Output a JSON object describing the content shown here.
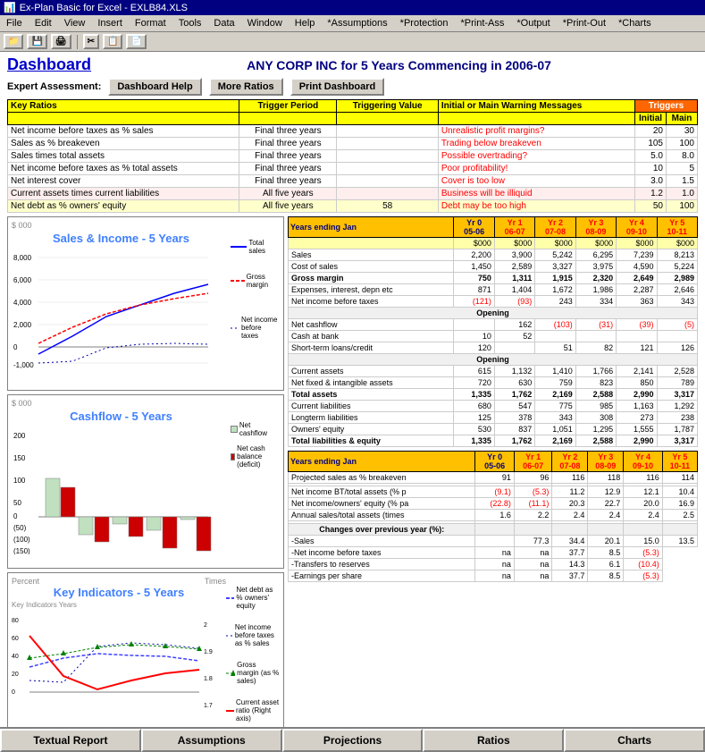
{
  "titlebar": {
    "title": "Ex-Plan Basic for Excel - EXLB84.XLS",
    "icon": "📊"
  },
  "menubar": {
    "items": [
      "File",
      "Edit",
      "View",
      "Insert",
      "Format",
      "Tools",
      "Data",
      "Window",
      "Help",
      "*Assumptions",
      "*Protection",
      "*Print-Ass",
      "*Output",
      "*Print-Out",
      "*Charts"
    ]
  },
  "dashboard": {
    "title": "Dashboard",
    "subtitle": "ANY CORP INC for 5 Years Commencing in 2006-07",
    "expert_label": "Expert Assessment:",
    "buttons": {
      "help": "Dashboard Help",
      "more_ratios": "More Ratios",
      "print": "Print Dashboard"
    }
  },
  "ratios_table": {
    "headers": [
      "Key Ratios",
      "Trigger Period",
      "Triggering Value",
      "Initial or Main Warning Messages",
      "Triggers Initial",
      "Triggers Main"
    ],
    "rows": [
      {
        "name": "Net income before taxes as % sales",
        "period": "Final three years",
        "value": "",
        "warning": "Unrealistic profit margins?",
        "initial": "20",
        "main": "30"
      },
      {
        "name": "Sales as % breakeven",
        "period": "Final three years",
        "value": "",
        "warning": "Trading below breakeven",
        "initial": "105",
        "main": "100"
      },
      {
        "name": "Sales times total assets",
        "period": "Final three years",
        "value": "",
        "warning": "Possible overtrading?",
        "initial": "5.0",
        "main": "8.0"
      },
      {
        "name": "Net income before taxes as % total assets",
        "period": "Final three years",
        "value": "",
        "warning": "Poor profitability!",
        "initial": "10",
        "main": "5"
      },
      {
        "name": "Net interest cover",
        "period": "Final three years",
        "value": "",
        "warning": "Cover is too low",
        "initial": "3.0",
        "main": "1.5"
      },
      {
        "name": "Current assets times current liabilities",
        "period": "All five years",
        "value": "",
        "warning": "Business will be illiquid",
        "initial": "1.2",
        "main": "1.0"
      },
      {
        "name": "Net debt as % owners' equity",
        "period": "All five years",
        "value": "58",
        "warning": "Debt may be too high",
        "initial": "50",
        "main": "100"
      }
    ]
  },
  "financial_data": {
    "years_header": [
      "Years ending Jan",
      "Yr 0 05-06",
      "Yr 1 06-07",
      "Yr 2 07-08",
      "Yr 3 08-09",
      "Yr 4 09-10",
      "Yr 5 10-11"
    ],
    "unit_row": [
      "$000",
      "$000",
      "$000",
      "$000",
      "$000",
      "$000"
    ],
    "income": [
      {
        "label": "Sales",
        "values": [
          "2,200",
          "3,900",
          "5,242",
          "6,295",
          "7,239",
          "8,213"
        ]
      },
      {
        "label": "Cost of sales",
        "values": [
          "1,450",
          "2,589",
          "3,327",
          "3,975",
          "4,590",
          "5,224"
        ]
      },
      {
        "label": "Gross margin",
        "values": [
          "750",
          "1,311",
          "1,915",
          "2,320",
          "2,649",
          "2,989"
        ]
      }
    ],
    "expenses": [
      {
        "label": "Expenses, interest, depn etc",
        "values": [
          "871",
          "1,404",
          "1,672",
          "1,986",
          "2,287",
          "2,646"
        ]
      },
      {
        "label": "Net income before taxes",
        "values": [
          "(121)",
          "(93)",
          "243",
          "334",
          "363",
          "343"
        ]
      }
    ],
    "cashflow": [
      {
        "label": "Net cashflow",
        "values": [
          "",
          "162",
          "(103)",
          "(31)",
          "(39)",
          "(5)"
        ]
      },
      {
        "label": "Cash at bank",
        "values": [
          "10",
          "52",
          "",
          "",
          "",
          ""
        ]
      },
      {
        "label": "Short-term loans/credit",
        "values": [
          "120",
          "",
          "51",
          "82",
          "121",
          "126"
        ]
      }
    ],
    "assets": [
      {
        "label": "Current assets",
        "values": [
          "615",
          "1,132",
          "1,410",
          "1,766",
          "2,141",
          "2,528"
        ]
      },
      {
        "label": "Net fixed & intangible assets",
        "values": [
          "720",
          "630",
          "759",
          "823",
          "850",
          "789"
        ]
      },
      {
        "label": "Total assets",
        "values": [
          "1,335",
          "1,762",
          "2,169",
          "2,588",
          "2,990",
          "3,317"
        ]
      }
    ],
    "liabilities": [
      {
        "label": "Current liabilities",
        "values": [
          "680",
          "547",
          "775",
          "985",
          "1,163",
          "1,292"
        ]
      },
      {
        "label": "Longterm liabilities",
        "values": [
          "125",
          "378",
          "343",
          "308",
          "273",
          "238"
        ]
      },
      {
        "label": "Owners' equity",
        "values": [
          "530",
          "837",
          "1,051",
          "1,295",
          "1,555",
          "1,787"
        ]
      },
      {
        "label": "Total liabilities & equity",
        "values": [
          "1,335",
          "1,762",
          "2,169",
          "2,588",
          "2,990",
          "3,317"
        ]
      }
    ]
  },
  "ratios_data": {
    "years_header": [
      "Years ending Jan",
      "Yr 0 05-06",
      "Yr 1 06-07",
      "Yr 2 07-08",
      "Yr 3 08-09",
      "Yr 4 09-10",
      "Yr 5 10-11"
    ],
    "rows": [
      {
        "label": "Projected sales as % breakeven",
        "values": [
          "91",
          "96",
          "116",
          "118",
          "116",
          "114"
        ]
      },
      {
        "label": "",
        "values": [
          "",
          "",
          "",
          "",
          "",
          ""
        ]
      },
      {
        "label": "Net income BT/total assets (% p",
        "values": [
          "(9.1)",
          "(5.3)",
          "11.2",
          "12.9",
          "12.1",
          "10.4"
        ],
        "neg": [
          true,
          true,
          false,
          false,
          false,
          false
        ]
      },
      {
        "label": "Net income/owners' equity (% pa",
        "values": [
          "(22.8)",
          "(11.1)",
          "20.3",
          "22.7",
          "20.0",
          "16.9"
        ],
        "neg": [
          true,
          true,
          false,
          false,
          false,
          false
        ]
      },
      {
        "label": "Annual sales/total assets (times",
        "values": [
          "1.6",
          "2.2",
          "2.4",
          "2.4",
          "2.4",
          "2.5"
        ]
      },
      {
        "label": "",
        "values": [
          "",
          "",
          "",
          "",
          "",
          ""
        ]
      },
      {
        "label": "Changes over previous year (%):",
        "values": [
          "",
          "",
          "",
          "",
          "",
          ""
        ],
        "section": true
      },
      {
        "label": " -Sales",
        "values": [
          "",
          "77.3",
          "34.4",
          "20.1",
          "15.0",
          "13.5"
        ]
      },
      {
        "label": " -Net income before taxes",
        "values": [
          "na",
          "na",
          "37.7",
          "8.5",
          "(5.3)"
        ],
        "neg5": true
      },
      {
        "label": " -Transfers to reserves",
        "values": [
          "na",
          "na",
          "14.3",
          "6.1",
          "(10.4)"
        ],
        "neg5": true
      },
      {
        "label": " -Earnings per share",
        "values": [
          "na",
          "na",
          "37.7",
          "8.5",
          "(5.3)"
        ],
        "neg5": true
      }
    ]
  },
  "charts": {
    "sales_income_title": "Sales & Income - 5 Years",
    "cashflow_title": "Cashflow - 5 Years",
    "key_indicators_title": "Key Indicators - 5 Years",
    "key_indicators_label": "Key Indicators Years"
  },
  "bottom_nav": {
    "buttons": [
      "Textual Report",
      "Assumptions",
      "Projections",
      "Ratios",
      "Charts"
    ]
  }
}
